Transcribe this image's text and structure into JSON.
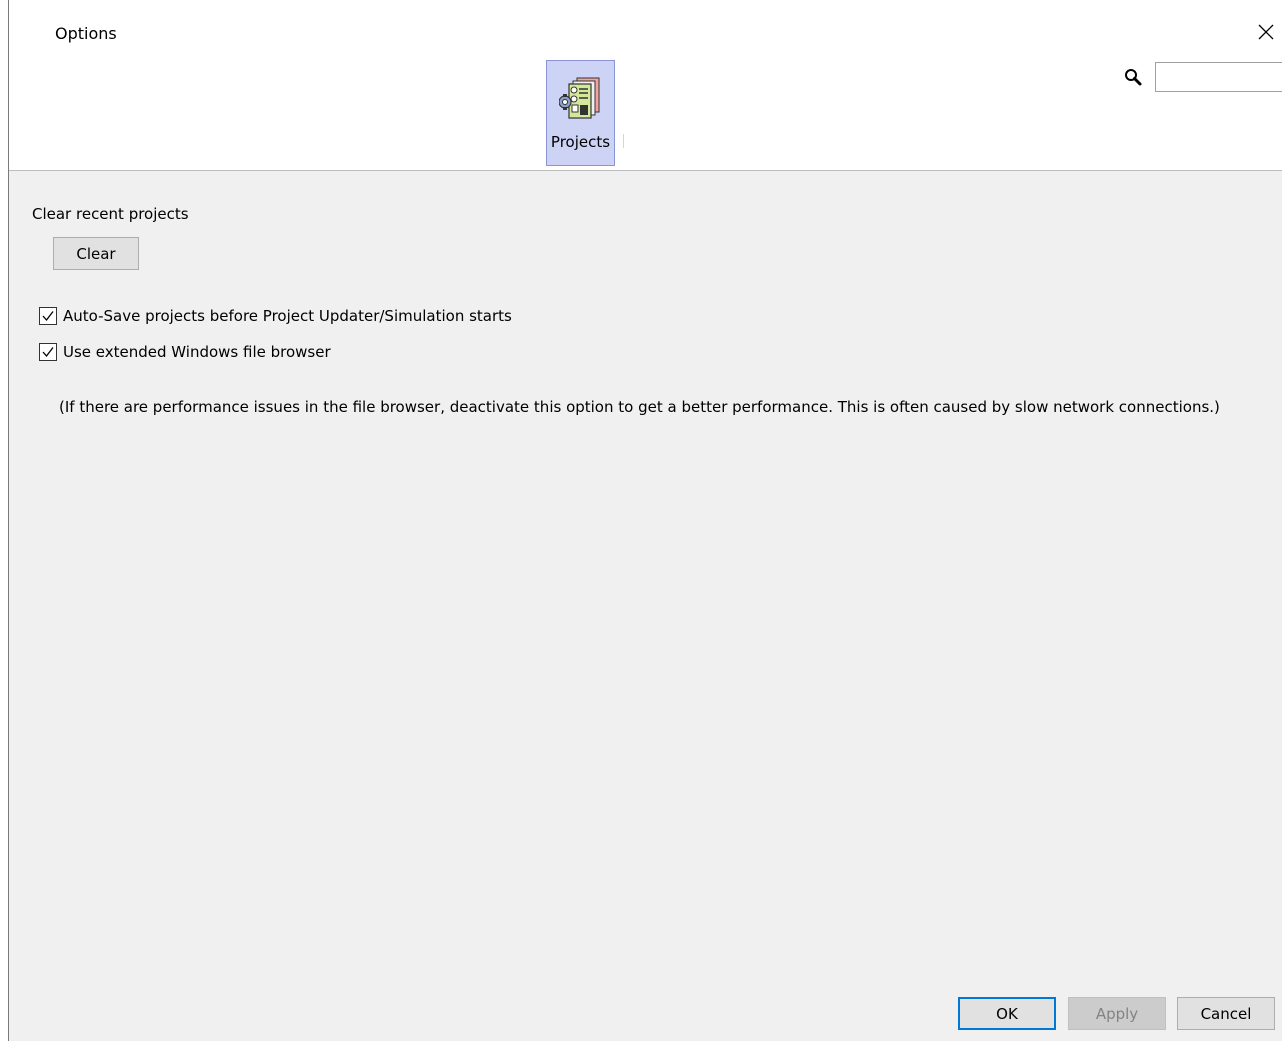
{
  "window": {
    "title": "Options",
    "close_icon": "close-icon"
  },
  "categories": [
    {
      "label": "Projects",
      "icon": "projects-icon",
      "selected": true
    }
  ],
  "search": {
    "icon": "search-icon",
    "value": "",
    "placeholder": ""
  },
  "content": {
    "section_label": "Clear recent projects",
    "clear_label": "Clear",
    "options": [
      {
        "label": "Auto-Save projects before Project Updater/Simulation starts",
        "checked": true
      },
      {
        "label": "Use extended Windows file browser",
        "checked": true
      }
    ],
    "info_text": "(If there are performance issues in the file browser, deactivate this option to get a better performance. This is often caused by slow network connections.)"
  },
  "footer": {
    "ok_label": "OK",
    "apply_label": "Apply",
    "apply_enabled": false,
    "cancel_label": "Cancel"
  },
  "colors": {
    "selected_tile_bg": "#cdd3f5",
    "selected_tile_border": "#8c94d8",
    "dialog_bg": "#f0f0f0",
    "default_button_border": "#0078d7"
  }
}
